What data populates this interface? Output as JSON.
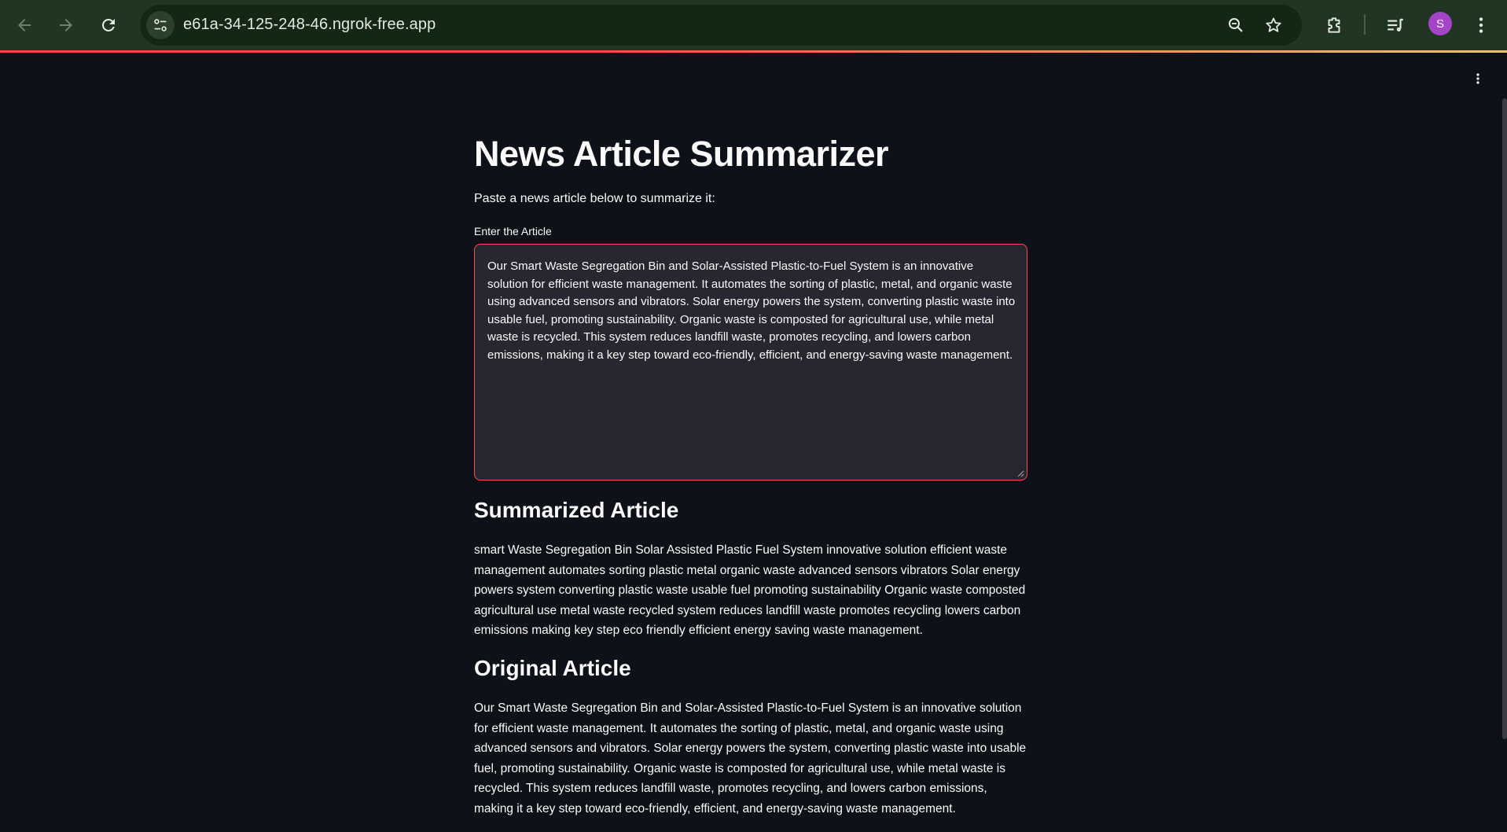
{
  "browser": {
    "url": "e61a-34-125-248-46.ngrok-free.app",
    "profile_initial": "S",
    "icons": {
      "back": "back-arrow-icon",
      "forward": "forward-arrow-icon",
      "reload": "reload-icon",
      "site_info": "tune-icon",
      "zoom": "zoom-icon",
      "bookmark": "star-icon",
      "extensions": "puzzle-icon",
      "media": "media-queue-icon",
      "menu": "kebab-menu-icon"
    },
    "colors": {
      "toolbar": "#213622",
      "accent_line": "#ff4b4b",
      "avatar": "#a543c9"
    }
  },
  "app": {
    "title": "News Article Summarizer",
    "intro": "Paste a news article below to summarize it:",
    "input_label": "Enter the Article",
    "input_value": "Our Smart Waste Segregation Bin and Solar-Assisted Plastic-to-Fuel System is an innovative solution for efficient waste management. It automates the sorting of plastic, metal, and organic waste using advanced sensors and vibrators. Solar energy powers the system, converting plastic waste into usable fuel, promoting sustainability. Organic waste is composted for agricultural use, while metal waste is recycled. This system reduces landfill waste, promotes recycling, and lowers carbon emissions, making it a key step toward eco-friendly, efficient, and energy-saving waste management.",
    "summary_heading": "Summarized Article",
    "summary_text": "smart Waste Segregation Bin Solar Assisted Plastic Fuel System innovative solution efficient waste management automates sorting plastic metal organic waste advanced sensors vibrators Solar energy powers system converting plastic waste usable fuel promoting sustainability Organic waste composted agricultural use metal waste recycled system reduces landfill waste promotes recycling lowers carbon emissions making key step eco friendly efficient energy saving waste management.",
    "original_heading": "Original Article",
    "original_text": "Our Smart Waste Segregation Bin and Solar-Assisted Plastic-to-Fuel System is an innovative solution for efficient waste management. It automates the sorting of plastic, metal, and organic waste using advanced sensors and vibrators. Solar energy powers the system, converting plastic waste into usable fuel, promoting sustainability. Organic waste is composted for agricultural use, while metal waste is recycled. This system reduces landfill waste, promotes recycling, and lowers carbon emissions, making it a key step toward eco-friendly, efficient, and energy-saving waste management.",
    "colors": {
      "background": "#0e1117",
      "text": "#fafafa",
      "input_bg": "#262730",
      "input_border": "#ff4b4b"
    }
  }
}
